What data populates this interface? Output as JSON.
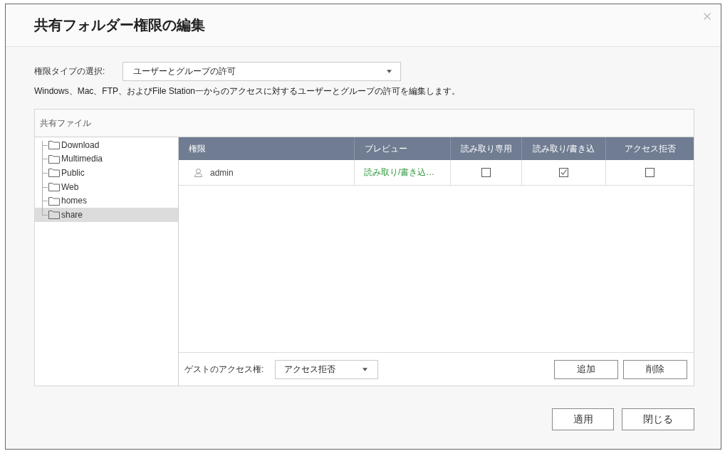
{
  "dialog": {
    "title": "共有フォルダー権限の編集"
  },
  "permission_type": {
    "label": "権限タイプの選択:",
    "value": "ユーザーとグループの許可"
  },
  "description": "Windows、Mac、FTP、およびFile Station一からのアクセスに対するユーザーとグループの許可を編集します。",
  "shared_files": {
    "title": "共有ファイル",
    "folders": [
      {
        "name": "Download",
        "selected": false
      },
      {
        "name": "Multimedia",
        "selected": false
      },
      {
        "name": "Public",
        "selected": false
      },
      {
        "name": "Web",
        "selected": false
      },
      {
        "name": "homes",
        "selected": false
      },
      {
        "name": "share",
        "selected": true
      }
    ]
  },
  "table": {
    "columns": [
      "権限",
      "プレビュー",
      "読み取り専用",
      "読み取り/書き込",
      "アクセス拒否"
    ],
    "rows": [
      {
        "kind": "user",
        "name": "admin",
        "preview": "読み取り/書き込…",
        "checks": [
          {
            "checked": false
          },
          {
            "checked": true
          },
          {
            "checked": false
          }
        ]
      }
    ]
  },
  "guest_access": {
    "label": "ゲストのアクセス権:",
    "value": "アクセス拒否"
  },
  "table_buttons": [
    "追加",
    "削除"
  ],
  "buttons": [
    "適用",
    "閉じる"
  ]
}
